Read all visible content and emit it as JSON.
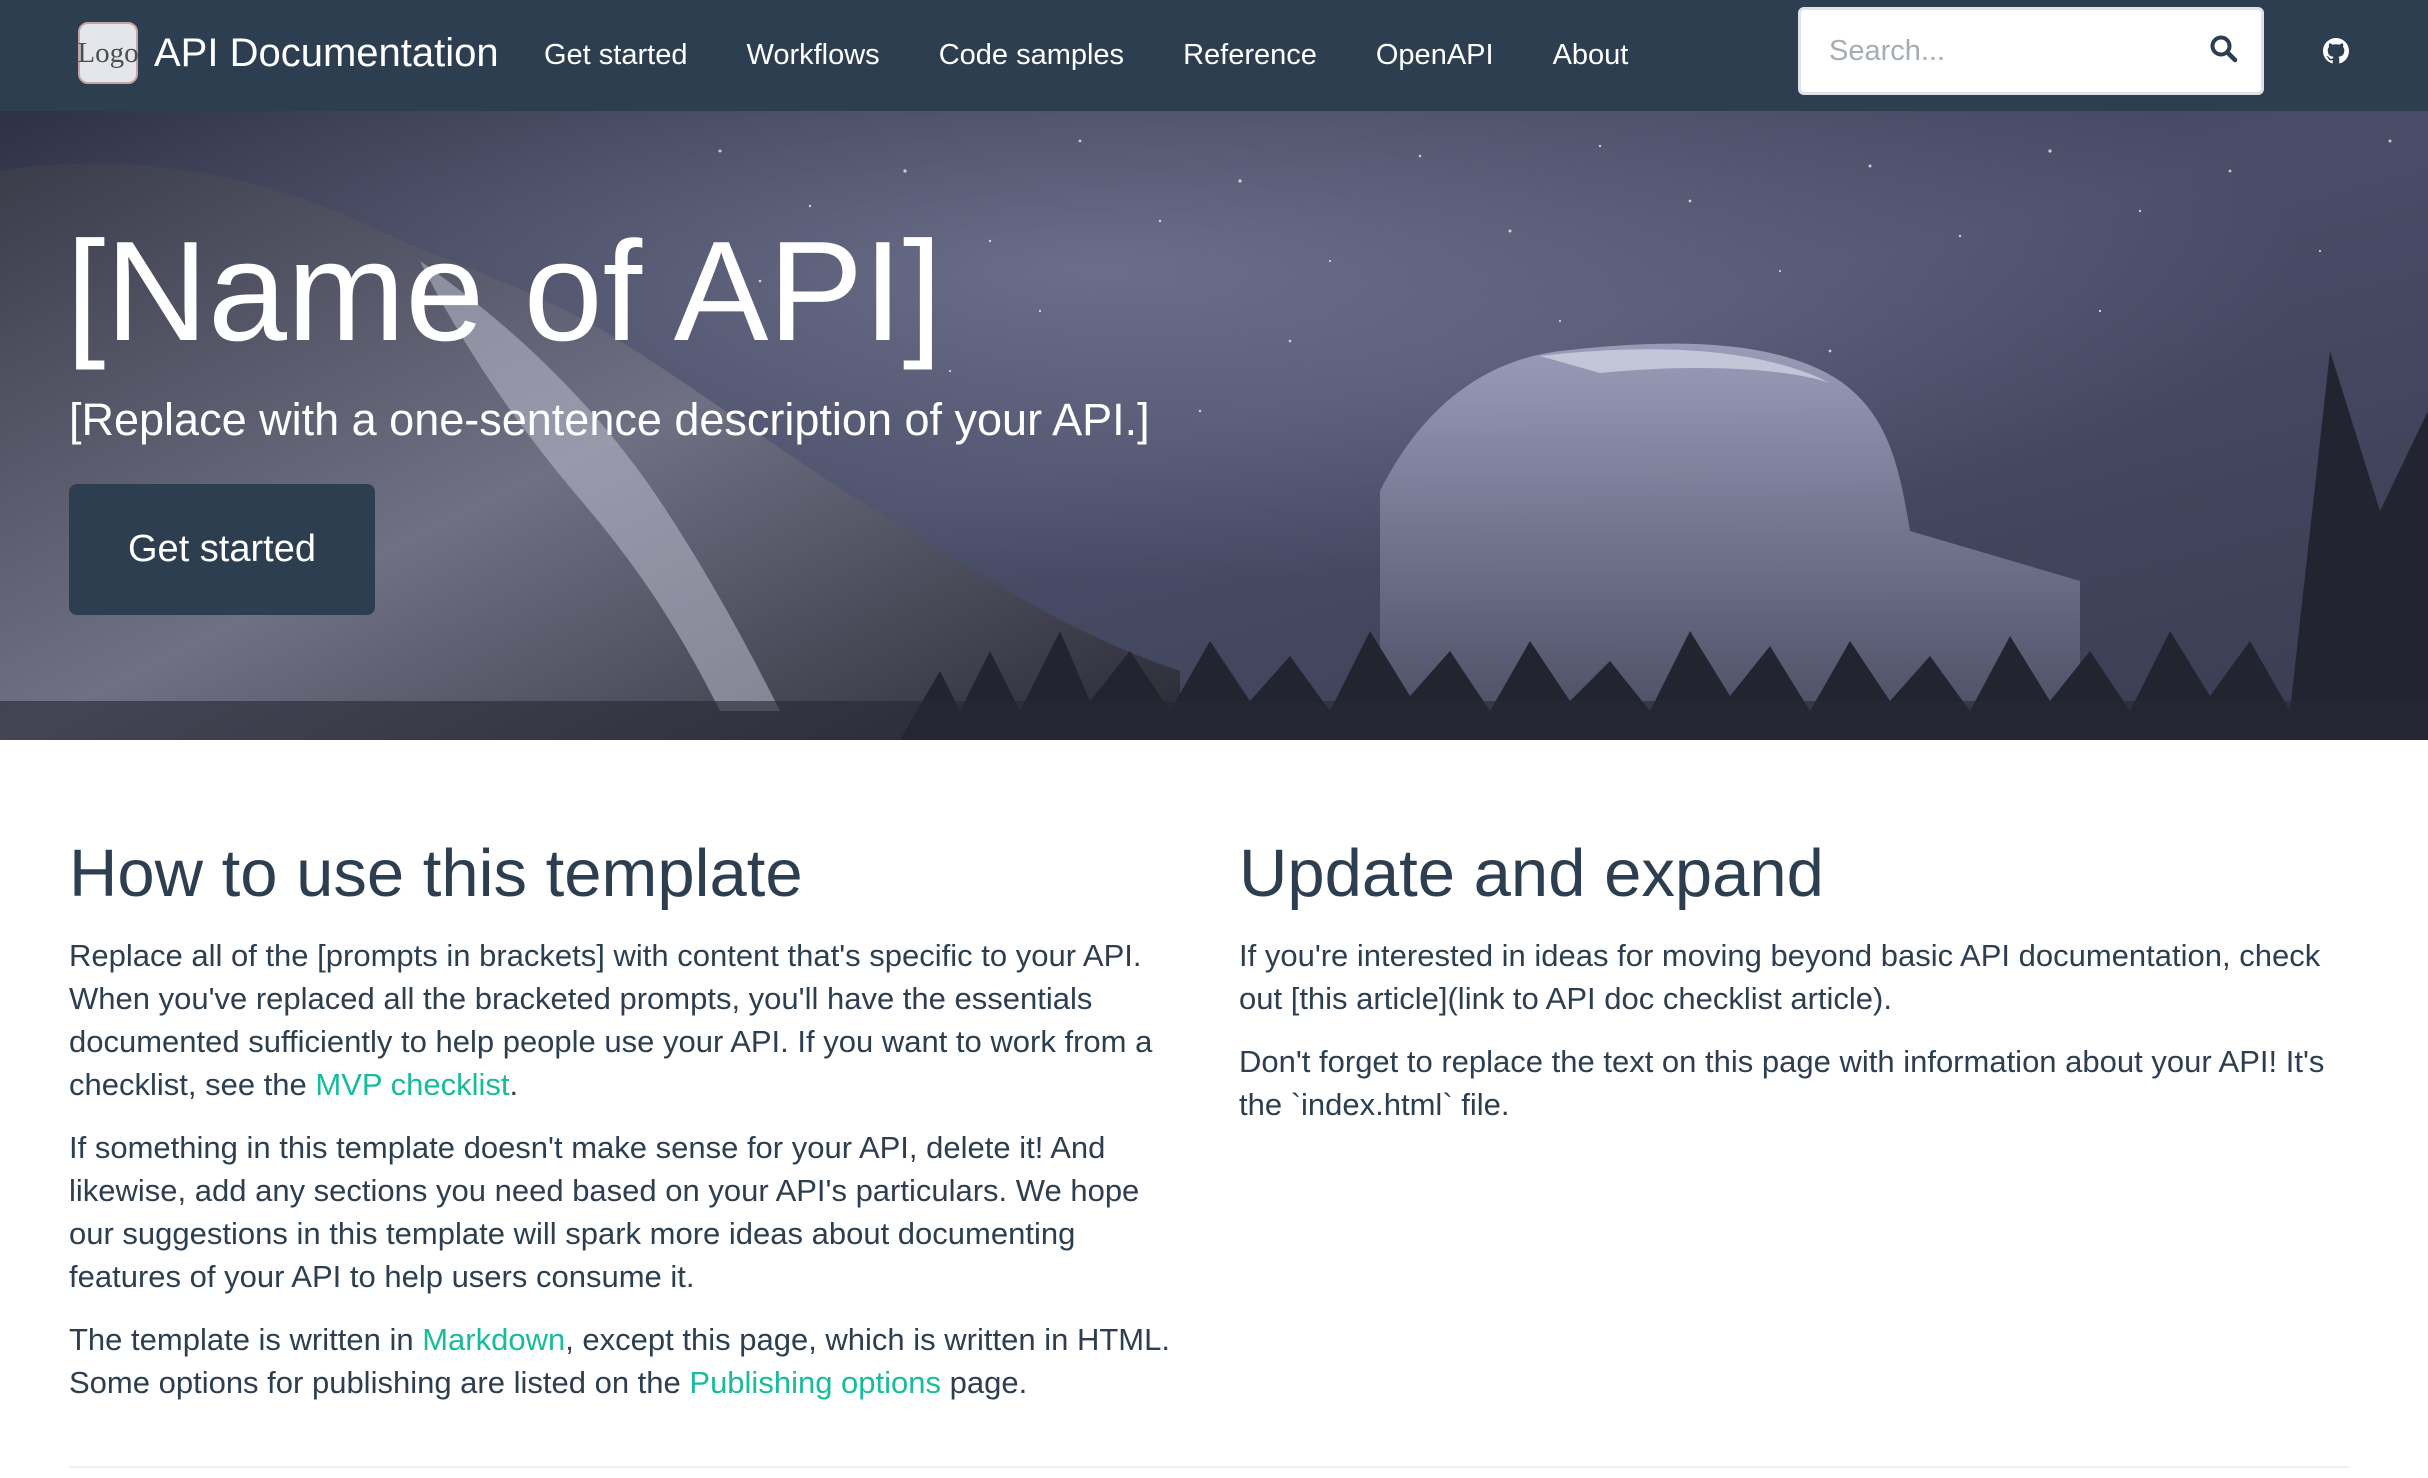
{
  "navbar": {
    "logo_text": "Logo",
    "brand_title": "API Documentation",
    "links": [
      {
        "label": "Get started"
      },
      {
        "label": "Workflows"
      },
      {
        "label": "Code samples"
      },
      {
        "label": "Reference"
      },
      {
        "label": "OpenAPI"
      },
      {
        "label": "About"
      }
    ],
    "search_placeholder": "Search...",
    "search_icon": "magnifier-icon",
    "github_icon": "github-icon"
  },
  "hero": {
    "title": "[Name of API]",
    "subtitle": "[Replace with a one-sentence description of your API.]",
    "button_label": "Get started"
  },
  "left_section": {
    "heading": "How to use this template",
    "p1_text": "Replace all of the [prompts in brackets] with content that's specific to your API. When you've replaced all the bracketed prompts, you'll have the essentials documented sufficiently to help people use your API. If you want to work from a checklist, see the ",
    "p1_link": "MVP checklist",
    "p1_end": ".",
    "p2_text": "If something in this template doesn't make sense for your API, delete it! And likewise, add any sections you need based on your API's particulars. We hope our suggestions in this template will spark more ideas about documenting features of your API to help users consume it.",
    "p3_start": "The template is written in ",
    "p3_link1": "Markdown",
    "p3_mid": ", except this page, which is written in HTML. Some options for publishing are listed on the ",
    "p3_link2": "Publishing options",
    "p3_end": " page."
  },
  "right_section": {
    "heading": "Update and expand",
    "p1_text": "If you're interested in ideas for moving beyond basic API documentation, check out [this article](link to API doc checklist article).",
    "p2_text": "Don't forget to replace the text on this page with information about your API! It's the `index.html` file."
  },
  "colors": {
    "navbar_bg": "#2c3e50",
    "link": "#18bc9c",
    "text": "#2c3e50"
  }
}
